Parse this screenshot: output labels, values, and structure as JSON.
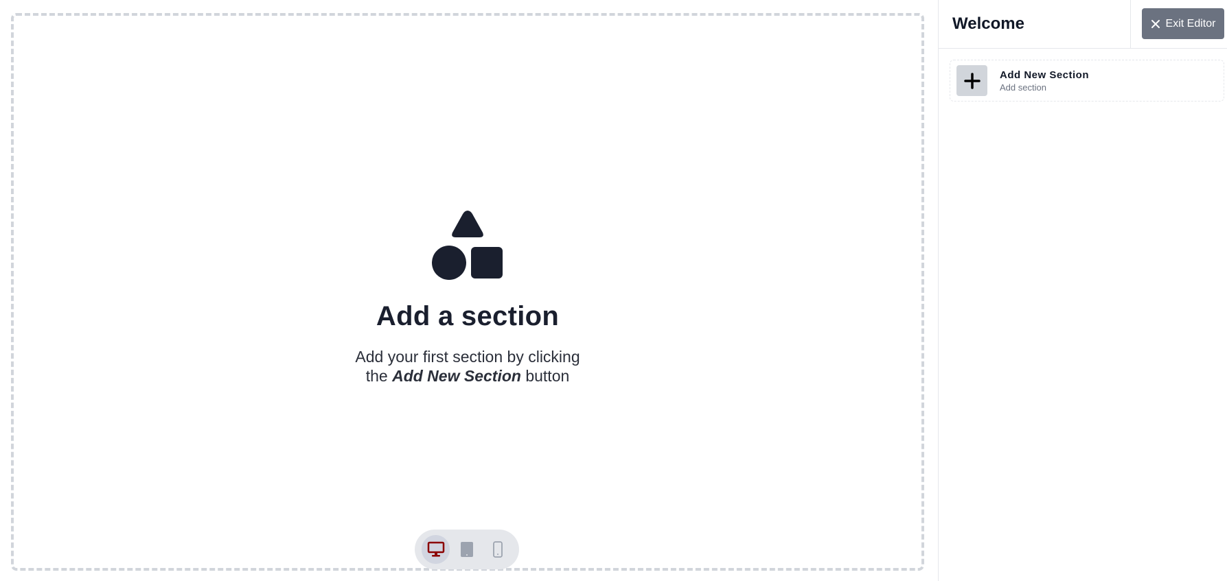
{
  "canvas": {
    "empty_state": {
      "icon": "shapes-icon",
      "title": "Add a section",
      "desc_line1": "Add your first section by clicking",
      "desc_prefix": "the",
      "desc_emphasis": "Add New Section",
      "desc_suffix": "button"
    },
    "device_toggle": {
      "active": "desktop",
      "devices": [
        {
          "name": "desktop",
          "icon": "monitor-icon",
          "color": "#8b0000"
        },
        {
          "name": "tablet",
          "icon": "tablet-icon",
          "color": "#9ca3af"
        },
        {
          "name": "mobile",
          "icon": "mobile-icon",
          "color": "#9ca3af"
        }
      ]
    }
  },
  "sidebar": {
    "title": "Welcome",
    "exit_button": {
      "label": "Exit Editor",
      "icon": "close-icon"
    },
    "add_section": {
      "icon": "plus-icon",
      "title": "Add New Section",
      "subtitle": "Add section"
    }
  },
  "colors": {
    "shape_fill": "#1a1f2e",
    "exit_button_bg": "#6b7280",
    "active_device": "#8b0000",
    "inactive_device": "#9ca3af"
  }
}
